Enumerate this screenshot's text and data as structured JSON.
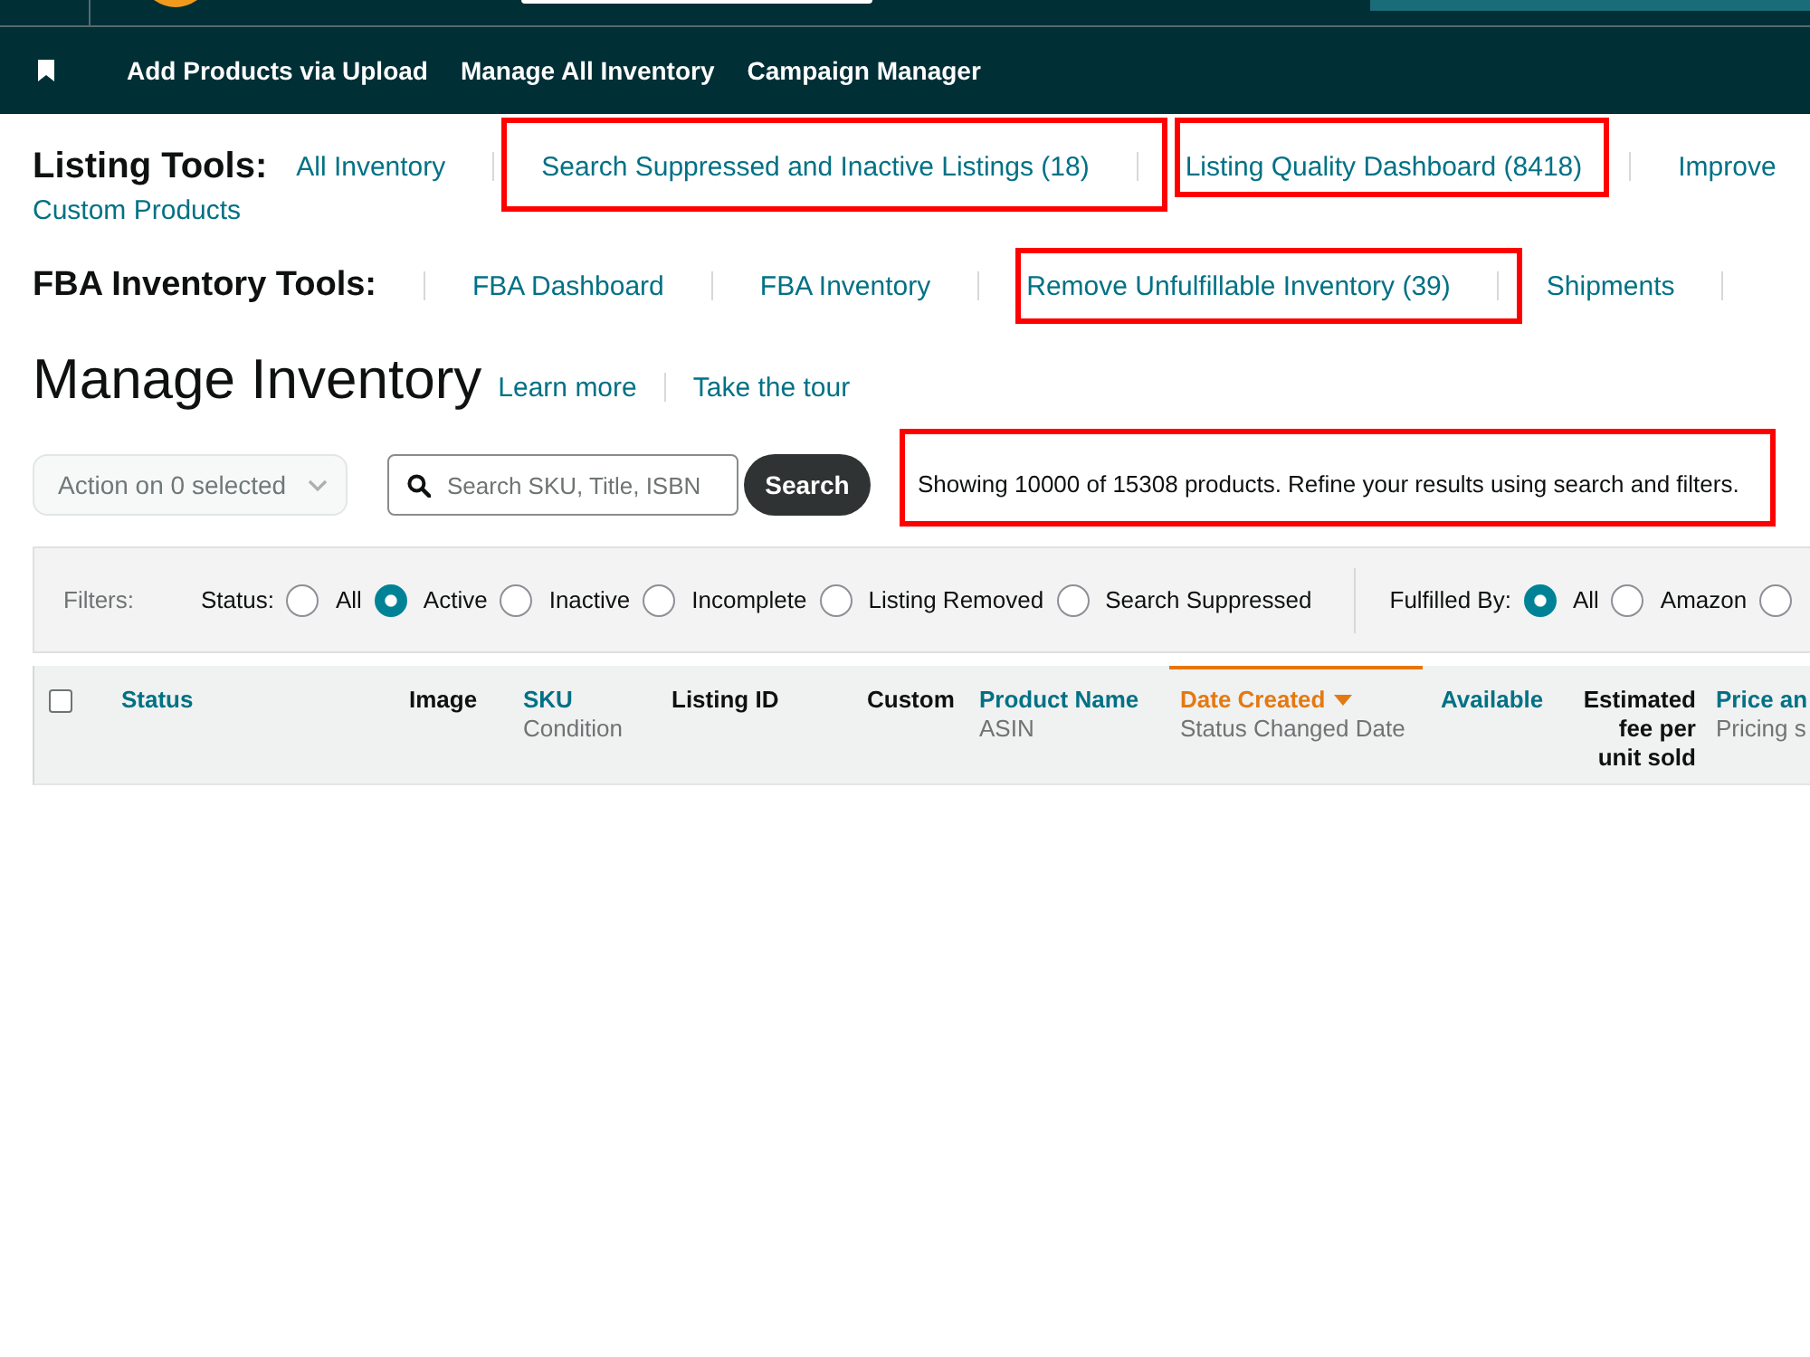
{
  "nav": {
    "items": [
      "Add Products via Upload",
      "Manage All Inventory",
      "Campaign Manager"
    ]
  },
  "listing_tools": {
    "title": "Listing Tools:",
    "lines": [
      {
        "links": [
          {
            "label": "All Inventory",
            "highlighted": false
          },
          {
            "label": "Search Suppressed and Inactive Listings (18)",
            "highlighted": true
          },
          {
            "label": "Listing Quality Dashboard (8418)",
            "highlighted": true
          },
          {
            "label": "Improve",
            "highlighted": false
          }
        ]
      },
      {
        "links": [
          {
            "label": "Custom Products",
            "highlighted": false
          }
        ]
      }
    ]
  },
  "fba_tools": {
    "title": "FBA Inventory Tools:",
    "links": [
      {
        "label": "FBA Dashboard",
        "highlighted": false
      },
      {
        "label": "FBA Inventory",
        "highlighted": false
      },
      {
        "label": "Remove Unfulfillable Inventory (39)",
        "highlighted": true
      },
      {
        "label": "Shipments",
        "highlighted": false
      }
    ]
  },
  "page_header": {
    "title": "Manage Inventory",
    "links": [
      "Learn more",
      "Take the tour"
    ]
  },
  "toolbar": {
    "action_menu": {
      "label": "Action on 0 selected",
      "disabled": true
    },
    "search": {
      "placeholder": "Search SKU, Title, ISBN",
      "button": "Search"
    },
    "result_message": {
      "text": "Showing 10000 of 15308 products. Refine your results using search and filters.",
      "highlighted": true
    }
  },
  "filters": {
    "label": "Filters:",
    "groups": [
      {
        "label": "Status:",
        "options": [
          {
            "label": "All",
            "selected": false
          },
          {
            "label": "Active",
            "selected": true
          },
          {
            "label": "Inactive",
            "selected": false
          },
          {
            "label": "Incomplete",
            "selected": false
          },
          {
            "label": "Listing Removed",
            "selected": false
          },
          {
            "label": "Search Suppressed",
            "selected": false
          }
        ]
      },
      {
        "label": "Fulfilled By:",
        "options": [
          {
            "label": "All",
            "selected": true
          },
          {
            "label": "Amazon",
            "selected": false
          },
          {
            "selected": false
          }
        ]
      }
    ]
  },
  "table": {
    "select_all": {
      "checked": false
    },
    "columns": [
      {
        "label": "Status",
        "kind": "sortable",
        "sorted": false
      },
      {
        "label": "Image",
        "kind": "plain",
        "sorted": false
      },
      {
        "label": "SKU",
        "sublabel": "Condition",
        "kind": "sortable",
        "sorted": false
      },
      {
        "label": "Listing ID",
        "kind": "plain",
        "sorted": false
      },
      {
        "label": "Custom",
        "kind": "plain",
        "sorted": false
      },
      {
        "label": "Product Name",
        "sublabel": "ASIN",
        "kind": "sortable",
        "sorted": false
      },
      {
        "label": "Date Created",
        "sublabel": "Status Changed Date",
        "kind": "sortable",
        "sorted": true
      },
      {
        "label": "Available",
        "kind": "sortable",
        "sorted": false
      },
      {
        "label": "Estimated fee per unit sold",
        "kind": "plain",
        "sorted": false
      },
      {
        "label": "Price an",
        "sublabel": "Pricing s",
        "kind": "sortable",
        "sorted": false
      }
    ]
  }
}
